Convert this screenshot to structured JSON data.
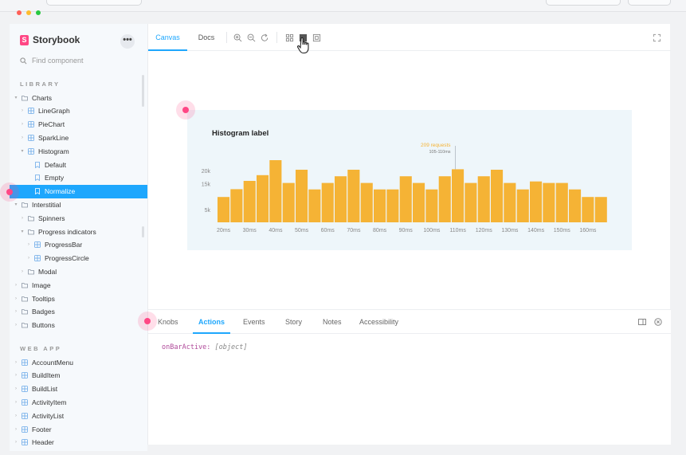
{
  "sidebar": {
    "brand": "Storybook",
    "more_label": "•••",
    "search_placeholder": "Find component",
    "library_heading": "LIBRARY",
    "library_items": [
      {
        "label": "Charts",
        "level": 0,
        "kind": "folder",
        "expanded": true
      },
      {
        "label": "LineGraph",
        "level": 1,
        "kind": "component"
      },
      {
        "label": "PieChart",
        "level": 1,
        "kind": "component"
      },
      {
        "label": "SparkLine",
        "level": 1,
        "kind": "component"
      },
      {
        "label": "Histogram",
        "level": 1,
        "kind": "component",
        "expanded": true
      },
      {
        "label": "Default",
        "level": 2,
        "kind": "story"
      },
      {
        "label": "Empty",
        "level": 2,
        "kind": "story"
      },
      {
        "label": "Normalize",
        "level": 2,
        "kind": "story",
        "selected": true
      },
      {
        "label": "Interstitial",
        "level": 0,
        "kind": "folder",
        "expanded": true
      },
      {
        "label": "Spinners",
        "level": 1,
        "kind": "folder"
      },
      {
        "label": "Progress indicators",
        "level": 1,
        "kind": "folder",
        "expanded": true
      },
      {
        "label": "ProgressBar",
        "level": 2,
        "kind": "component"
      },
      {
        "label": "ProgressCircle",
        "level": 2,
        "kind": "component"
      },
      {
        "label": "Modal",
        "level": 1,
        "kind": "folder"
      },
      {
        "label": "Image",
        "level": 0,
        "kind": "folder"
      },
      {
        "label": "Tooltips",
        "level": 0,
        "kind": "folder"
      },
      {
        "label": "Badges",
        "level": 0,
        "kind": "folder"
      },
      {
        "label": "Buttons",
        "level": 0,
        "kind": "folder"
      }
    ],
    "webapp_heading": "WEB APP",
    "webapp_items": [
      {
        "label": "AccountMenu",
        "kind": "component"
      },
      {
        "label": "BuildItem",
        "kind": "component"
      },
      {
        "label": "BuildList",
        "kind": "component"
      },
      {
        "label": "ActivityItem",
        "kind": "component"
      },
      {
        "label": "ActivityList",
        "kind": "component"
      },
      {
        "label": "Footer",
        "kind": "component"
      },
      {
        "label": "Header",
        "kind": "component"
      }
    ]
  },
  "toolbar": {
    "tabs": [
      "Canvas",
      "Docs"
    ],
    "active_tab": "Canvas",
    "tools": [
      "zoom-in-icon",
      "zoom-out-icon",
      "zoom-reset-icon",
      "grid-icon",
      "background-icon",
      "outline-icon"
    ],
    "fullscreen_icon": "fullscreen-icon"
  },
  "chart_data": {
    "type": "bar",
    "title": "Histogram label",
    "categories": [
      "20ms",
      "25ms",
      "30ms",
      "35ms",
      "40ms",
      "45ms",
      "50ms",
      "55ms",
      "60ms",
      "65ms",
      "70ms",
      "75ms",
      "80ms",
      "85ms",
      "90ms",
      "95ms",
      "100ms",
      "105ms",
      "110ms",
      "115ms",
      "120ms",
      "125ms",
      "130ms",
      "135ms",
      "140ms",
      "145ms",
      "150ms",
      "155ms",
      "160ms",
      "165ms"
    ],
    "values": [
      9800,
      12800,
      16000,
      18200,
      24000,
      15200,
      20300,
      12700,
      15200,
      17800,
      20300,
      15200,
      12700,
      12700,
      17800,
      15200,
      12700,
      17800,
      20500,
      15200,
      17800,
      20300,
      15200,
      12700,
      15800,
      15200,
      15200,
      12700,
      9800,
      9800
    ],
    "x_tick_labels": [
      "20ms",
      "30ms",
      "40ms",
      "50ms",
      "60ms",
      "70ms",
      "80ms",
      "90ms",
      "100ms",
      "110ms",
      "120ms",
      "130ms",
      "140ms",
      "150ms",
      "160ms"
    ],
    "y_tick_labels": [
      "20k",
      "15k",
      "5k"
    ],
    "ylim": [
      0,
      28000
    ],
    "bar_color": "#f5b335",
    "annotation": {
      "label": "209 requests",
      "sublabel": "105-110ms",
      "category": "110ms"
    }
  },
  "addons": {
    "tabs": [
      "Knobs",
      "Actions",
      "Events",
      "Story",
      "Notes",
      "Accessibility"
    ],
    "active_tab": "Actions",
    "log_key": "onBarActive:",
    "log_value": "[object]",
    "icons": [
      "panel-toggle-icon",
      "close-panel-icon"
    ]
  },
  "colors": {
    "accent": "#1ea7fd",
    "brand": "#ff4785",
    "bar": "#f5b335",
    "annotation": "#f5b335"
  }
}
